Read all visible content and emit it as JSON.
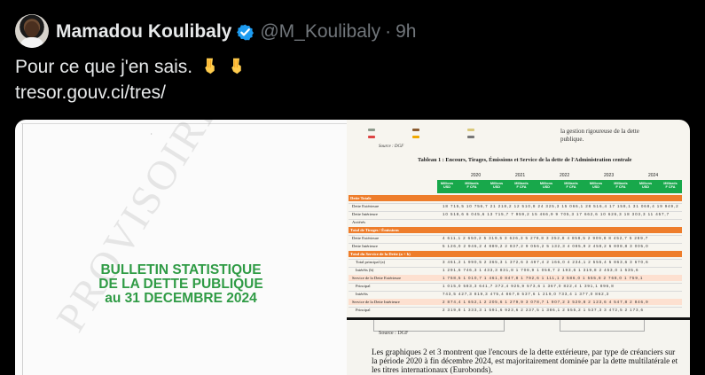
{
  "post": {
    "author_name": "Mamadou Koulibaly",
    "handle": "@M_Koulibaly",
    "separator": "·",
    "time": "9h",
    "text_line1": "Pour ce que j'en sais.",
    "text_line2": "tresor.gouv.ci/tres/",
    "emoji_names": [
      "backhand-index-pointing-down",
      "backhand-index-pointing-down"
    ]
  },
  "media": {
    "left_document": {
      "title_line1": "BULLETIN STATISTIQUE",
      "title_line2": "DE LA DETTE PUBLIQUE",
      "title_line3": "au 31 DECEMBRE 2024",
      "watermark": "PROVISOIRE"
    },
    "right_top_document": {
      "side_text_line1": "la gestion rigoureuse de la dette",
      "side_text_line2": "publique.",
      "source": "Source : DGF",
      "table_title": "Tableau 1 : Encours, Tirages, Émissions et Service de la dette de l'Administration centrale",
      "years": [
        "2020",
        "2021",
        "2022",
        "2023",
        "2024"
      ],
      "header_cells": [
        "Millions USD",
        "Milliards F CFA",
        "Millions USD",
        "Milliards F CFA",
        "Millions USD",
        "Milliards F CFA",
        "Millions USD",
        "Milliards F CFA",
        "Millions USD",
        "Milliards F CFA"
      ],
      "rows": [
        {
          "label": "Dette Totale",
          "kind": "orange"
        },
        {
          "label": "Dette Extérieure",
          "kind": "plain"
        },
        {
          "label": "Dette Intérieure",
          "kind": "plain"
        },
        {
          "label": "Arriérés",
          "kind": "plain"
        },
        {
          "label": "Total de Tirages / Émissions",
          "kind": "orange"
        },
        {
          "label": "Dette Extérieure",
          "kind": "plain"
        },
        {
          "label": "Dette Intérieure",
          "kind": "plain"
        },
        {
          "label": "Total du Service de la Dette (a + b)",
          "kind": "orange"
        },
        {
          "label": "Total principal (a)",
          "kind": "plain"
        },
        {
          "label": "Intérêts (b)",
          "kind": "plain"
        },
        {
          "label": "Service de la Dette Extérieure",
          "kind": "light"
        },
        {
          "label": "Principal",
          "kind": "plain"
        },
        {
          "label": "Intérêts",
          "kind": "plain"
        },
        {
          "label": "Service de la Dette Intérieure",
          "kind": "light"
        },
        {
          "label": "Principal",
          "kind": "plain"
        }
      ],
      "sample_numbers": [
        "18 715,5    10 756,7   21 218,2   12 510,8   24 325,3   15 066,1   28 516,4   17 158,1   31 068,4   19 949,2",
        "10 518,6    6 045,6   13 715,7    7 959,2   15 466,9    9 705,3   17 662,6   10 626,3   18 303,3   11 457,7",
        "4 611,1     2 650,2    5 319,5    3 626,3    5 278,8    3 352,8    4 858,5    2 909,8    8 452,7    5 289,7",
        "5 126,0     2 946,2    4 889,2    2 837,2    9 056,2    5 132,3    4 085,9    2 458,2    6 808,8    3 005,0",
        "3 461,2     1 990,5    2 365,3    1 372,6    3 497,4    2 166,0    4 234,1    2 555,4    5 863,6    3 670,6",
        "1 291,6       746,3    1 433,3      831,8    1 708,9    1 058,7    2 193,6    1 319,8    2 453,0    1 535,6",
        "1 758,5     1 010,7    1 461,0      847,8    1 792,6    1 111,1    2 586,0    1 555,8    2 768,0    1 759,1",
        "1 015,0       583,3      641,7      372,4      925,9      573,6    1 367,0      822,4    1 391,1      896,8",
        "743,5         427,3      819,3      475,4      867,8      537,6    1 219,0      733,4    1 377,0      862,3",
        "2 874,4     1 652,1    2 205,6    1 279,9    3 078,7    1 907,2    3 529,8    2 123,6    4 547,8    2 846,9",
        "2 319,8     1 333,3    1 591,6      923,6    2 237,5    1 386,1    2 555,2    1 537,3    3 472,5    2 173,6"
      ]
    },
    "right_bottom_document": {
      "source": "Source : DGF",
      "paragraph": "Les graphiques 2 et 3 montrent que l'encours de la dette extérieure, par type de créanciers sur la période 2020 à fin décembre 2024, est majoritairement dominée par la dette multilatérale et les titres internationaux (Eurobonds)."
    }
  },
  "colors": {
    "background": "#000000",
    "text": "#e7e9ea",
    "muted": "#71767b",
    "verified": "#1d9bf0",
    "bulletin_green": "#2f9b45",
    "table_green": "#18a84b",
    "table_orange": "#ee7d2b"
  }
}
